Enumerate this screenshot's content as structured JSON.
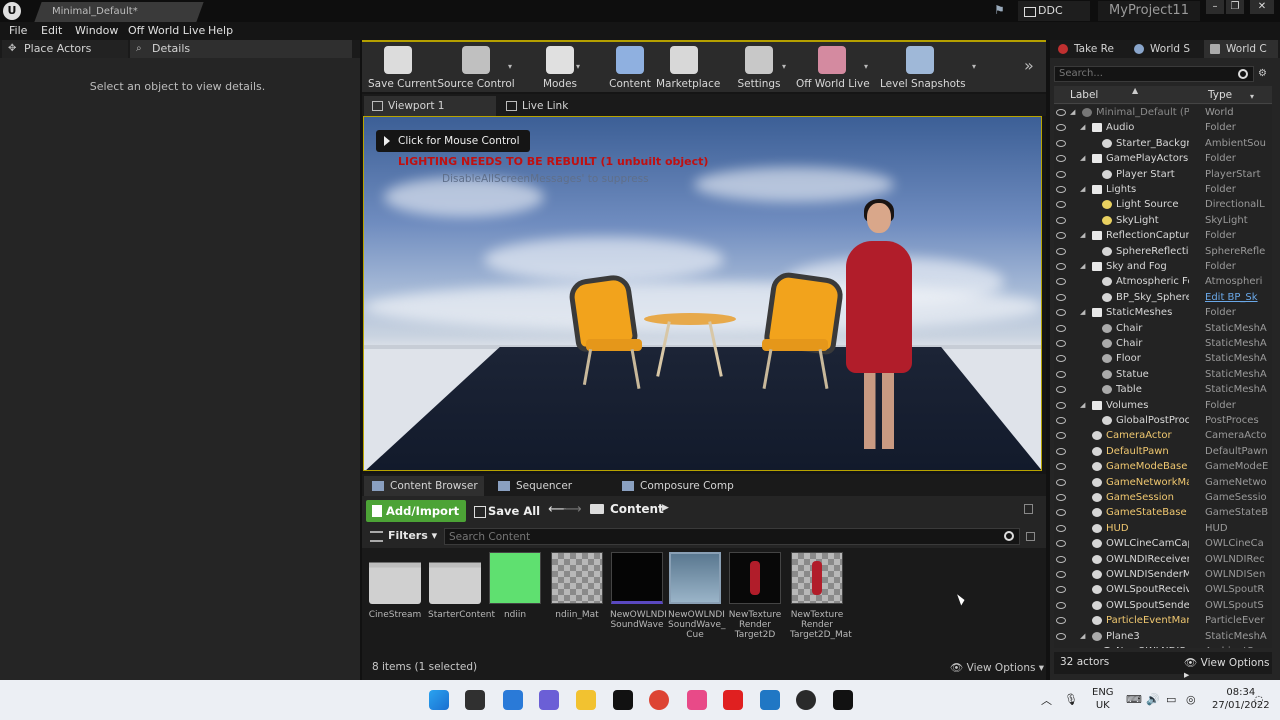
{
  "window": {
    "doc_tab": "Minimal_Default*",
    "ddc_label": "DDC",
    "project_name": "MyProject11"
  },
  "menu": [
    "File",
    "Edit",
    "Window",
    "Off World Live",
    "Help"
  ],
  "left_panel": {
    "tabs": [
      "Place Actors",
      "Details"
    ],
    "empty_message": "Select an object to view details."
  },
  "toolbar": {
    "buttons": [
      {
        "label": "Save Current",
        "icon": "save-icon",
        "color": "#dcdcdc"
      },
      {
        "label": "Source Control",
        "icon": "source-control-icon",
        "color": "#c0c0c0"
      },
      {
        "label": "Modes",
        "icon": "modes-icon",
        "color": "#e0e0e0"
      },
      {
        "label": "Content",
        "icon": "content-icon",
        "color": "#8fb0e0"
      },
      {
        "label": "Marketplace",
        "icon": "marketplace-icon",
        "color": "#d8d8d8"
      },
      {
        "label": "Settings",
        "icon": "settings-icon",
        "color": "#c8c8c8"
      },
      {
        "label": "Off World Live",
        "icon": "person-icon",
        "color": "#d48aa0"
      },
      {
        "label": "Level Snapshots",
        "icon": "snapshot-icon",
        "color": "#9fb8d8"
      }
    ]
  },
  "viewport": {
    "tabs": [
      "Viewport 1",
      "Live Link"
    ],
    "mouse_control": "Click for Mouse Control",
    "lighting_warning": "LIGHTING NEEDS TO BE REBUILT (1 unbuilt object)",
    "suppress_message": "DisableAllScreenMessages' to suppress"
  },
  "content_browser": {
    "tabs": [
      "Content Browser",
      "Sequencer",
      "Composure Comp"
    ],
    "add_import": "Add/Import",
    "save_all": "Save All",
    "breadcrumb": "Content",
    "filters": "Filters",
    "search_placeholder": "Search Content",
    "assets": [
      {
        "name": "CineStream",
        "kind": "folder"
      },
      {
        "name": "StarterContent",
        "kind": "folder"
      },
      {
        "name": "ndiin",
        "kind": "texture"
      },
      {
        "name": "ndiin_Mat",
        "kind": "material"
      },
      {
        "name": "NewOWLNDI SoundWave",
        "kind": "soundwave"
      },
      {
        "name": "NewOWLNDI SoundWave_ Cue",
        "kind": "soundcue"
      },
      {
        "name": "NewTexture Render Target2D",
        "kind": "render-target"
      },
      {
        "name": "NewTexture Render Target2D_Mat",
        "kind": "material"
      }
    ],
    "status": "8 items (1 selected)",
    "view_options": "View Options"
  },
  "right_panel": {
    "tabs": [
      "Take Re",
      "World S",
      "World C"
    ],
    "search_placeholder": "Search...",
    "columns": {
      "label": "Label",
      "type": "Type"
    },
    "rows": [
      {
        "label": "Minimal_Default (Play In",
        "type": "World",
        "indent": 1,
        "icon": "world",
        "expand": true,
        "dim": true
      },
      {
        "label": "Audio",
        "type": "Folder",
        "indent": 2,
        "icon": "folder",
        "expand": true
      },
      {
        "label": "Starter_Background",
        "type": "AmbientSou",
        "indent": 3,
        "icon": "actor"
      },
      {
        "label": "GamePlayActors",
        "type": "Folder",
        "indent": 2,
        "icon": "folder",
        "expand": true
      },
      {
        "label": "Player Start",
        "type": "PlayerStart",
        "indent": 3,
        "icon": "actor"
      },
      {
        "label": "Lights",
        "type": "Folder",
        "indent": 2,
        "icon": "folder",
        "expand": true
      },
      {
        "label": "Light Source",
        "type": "DirectionalL",
        "indent": 3,
        "icon": "light"
      },
      {
        "label": "SkyLight",
        "type": "SkyLight",
        "indent": 3,
        "icon": "light"
      },
      {
        "label": "ReflectionCaptureAc",
        "type": "Folder",
        "indent": 2,
        "icon": "folder",
        "expand": true
      },
      {
        "label": "SphereReflectionC",
        "type": "SphereRefle",
        "indent": 3,
        "icon": "actor"
      },
      {
        "label": "Sky and Fog",
        "type": "Folder",
        "indent": 2,
        "icon": "folder",
        "expand": true
      },
      {
        "label": "Atmospheric Fog",
        "type": "Atmospheri",
        "indent": 3,
        "icon": "actor"
      },
      {
        "label": "BP_Sky_Sphere",
        "type": "Edit BP_Sk",
        "indent": 3,
        "icon": "actor",
        "link": true
      },
      {
        "label": "StaticMeshes",
        "type": "Folder",
        "indent": 2,
        "icon": "folder",
        "expand": true
      },
      {
        "label": "Chair",
        "type": "StaticMeshA",
        "indent": 3,
        "icon": "mesh"
      },
      {
        "label": "Chair",
        "type": "StaticMeshA",
        "indent": 3,
        "icon": "mesh"
      },
      {
        "label": "Floor",
        "type": "StaticMeshA",
        "indent": 3,
        "icon": "mesh"
      },
      {
        "label": "Statue",
        "type": "StaticMeshA",
        "indent": 3,
        "icon": "mesh"
      },
      {
        "label": "Table",
        "type": "StaticMeshA",
        "indent": 3,
        "icon": "mesh"
      },
      {
        "label": "Volumes",
        "type": "Folder",
        "indent": 2,
        "icon": "folder",
        "expand": true
      },
      {
        "label": "GlobalPostProcess",
        "type": "PostProces",
        "indent": 3,
        "icon": "actor"
      },
      {
        "label": "CameraActor",
        "type": "CameraActo",
        "indent": 2,
        "icon": "actor",
        "highlight": true
      },
      {
        "label": "DefaultPawn",
        "type": "DefaultPawn",
        "indent": 2,
        "icon": "actor",
        "highlight": true
      },
      {
        "label": "GameModeBase",
        "type": "GameModeE",
        "indent": 2,
        "icon": "actor",
        "highlight": true
      },
      {
        "label": "GameNetworkManag",
        "type": "GameNetwo",
        "indent": 2,
        "icon": "actor",
        "highlight": true
      },
      {
        "label": "GameSession",
        "type": "GameSessio",
        "indent": 2,
        "icon": "actor",
        "highlight": true
      },
      {
        "label": "GameStateBase",
        "type": "GameStateB",
        "indent": 2,
        "icon": "actor",
        "highlight": true
      },
      {
        "label": "HUD",
        "type": "HUD",
        "indent": 2,
        "icon": "actor",
        "highlight": true
      },
      {
        "label": "OWLCineCamCaptur",
        "type": "OWLCineCa",
        "indent": 2,
        "icon": "actor"
      },
      {
        "label": "OWLNDIReceiverMar",
        "type": "OWLNDIRec",
        "indent": 2,
        "icon": "actor"
      },
      {
        "label": "OWLNDISenderMana",
        "type": "OWLNDISen",
        "indent": 2,
        "icon": "actor"
      },
      {
        "label": "OWLSpoutReceiverM",
        "type": "OWLSpoutR",
        "indent": 2,
        "icon": "actor"
      },
      {
        "label": "OWLSpoutSenderMa",
        "type": "OWLSpoutS",
        "indent": 2,
        "icon": "actor"
      },
      {
        "label": "ParticleEventManage",
        "type": "ParticleEver",
        "indent": 2,
        "icon": "actor",
        "highlight": true
      },
      {
        "label": "Plane3",
        "type": "StaticMeshA",
        "indent": 2,
        "icon": "mesh",
        "expand": true
      },
      {
        "label": "NewOWLNDISoundW",
        "type": "AmbientSou",
        "indent": 3,
        "icon": "actor"
      }
    ],
    "actors_count": "32 actors",
    "view_options": "View Options"
  },
  "taskbar": {
    "apps": [
      {
        "icon": "windows-start-icon",
        "color": "#1e8ce0"
      },
      {
        "icon": "task-view-icon",
        "color": "#303030"
      },
      {
        "icon": "widgets-icon",
        "color": "#2a7ad8"
      },
      {
        "icon": "chat-icon",
        "color": "#6b5fd6"
      },
      {
        "icon": "file-explorer-icon",
        "color": "#f2c230"
      },
      {
        "icon": "nvidia-app-icon",
        "color": "#111111"
      },
      {
        "icon": "chrome-icon",
        "color": "#dd4433"
      },
      {
        "icon": "app-icon",
        "color": "#e84a88"
      },
      {
        "icon": "media-icon",
        "color": "#e02020"
      },
      {
        "icon": "network-app-icon",
        "color": "#2077c4"
      },
      {
        "icon": "obs-icon",
        "color": "#2a2a2a"
      },
      {
        "icon": "unreal-icon",
        "color": "#111111"
      }
    ],
    "lang_top": "ENG",
    "lang_bottom": "UK",
    "time": "08:34",
    "date": "27/01/2022"
  }
}
